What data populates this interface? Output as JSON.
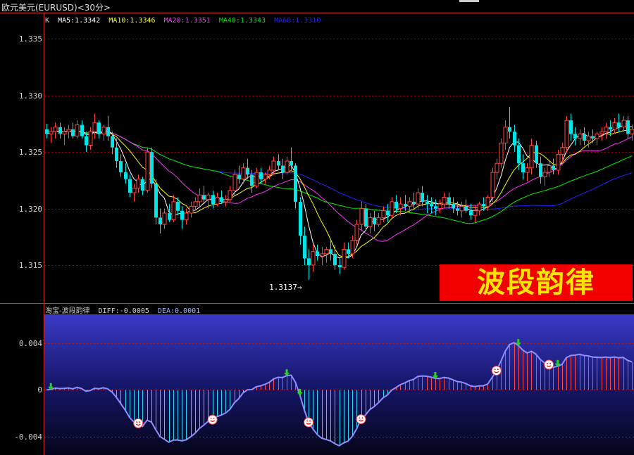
{
  "window": {
    "title": "欧元美元(EURUSD)<30分>"
  },
  "legend": {
    "k": "K",
    "ma5": "MA5:1.3342",
    "ma10": "MA10:1.3346",
    "ma20": "MA20:1.3351",
    "ma40": "MA40:1.3343",
    "ma60": "MA60:1.3310"
  },
  "indicator": {
    "name": "淘宝-波段韵律",
    "diff": "DIFF:-0.0005",
    "dea": "DEA:0.0001"
  },
  "banner": {
    "text": "波段韵律"
  },
  "annotation": {
    "low_label": "1.3137→"
  },
  "colors": {
    "up": "#ff4444",
    "down": "#00e5e5",
    "ma5": "#ffffff",
    "ma10": "#ffff00",
    "ma20": "#ff33ff",
    "ma40": "#00ee00",
    "ma60": "#2222ff",
    "grid": "#a00000"
  },
  "chart_data": [
    {
      "type": "candlestick",
      "title": "",
      "y_ticks": [
        "1.335",
        "1.330",
        "1.325",
        "1.320",
        "1.315"
      ],
      "ylim": [
        1.3117,
        1.3372
      ],
      "candles": [
        [
          1.327,
          1.3275,
          1.3262,
          1.3266
        ],
        [
          1.3266,
          1.3272,
          1.3258,
          1.3268
        ],
        [
          1.3268,
          1.3276,
          1.3262,
          1.3272
        ],
        [
          1.3272,
          1.3276,
          1.3262,
          1.3266
        ],
        [
          1.3266,
          1.3272,
          1.3256,
          1.3268
        ],
        [
          1.3268,
          1.3274,
          1.3262,
          1.327
        ],
        [
          1.327,
          1.3276,
          1.3262,
          1.3264
        ],
        [
          1.3264,
          1.3278,
          1.3262,
          1.3274
        ],
        [
          1.3274,
          1.3278,
          1.3262,
          1.3264
        ],
        [
          1.3264,
          1.3268,
          1.325,
          1.3256
        ],
        [
          1.3256,
          1.3272,
          1.3252,
          1.3268
        ],
        [
          1.3268,
          1.3284,
          1.3262,
          1.3276
        ],
        [
          1.3276,
          1.3278,
          1.3262,
          1.3266
        ],
        [
          1.3266,
          1.3274,
          1.326,
          1.3272
        ],
        [
          1.3272,
          1.3282,
          1.326,
          1.3264
        ],
        [
          1.3264,
          1.3268,
          1.3248,
          1.3254
        ],
        [
          1.3254,
          1.3262,
          1.3236,
          1.3242
        ],
        [
          1.3242,
          1.3248,
          1.3228,
          1.3232
        ],
        [
          1.3232,
          1.324,
          1.3222,
          1.3226
        ],
        [
          1.3226,
          1.323,
          1.321,
          1.3214
        ],
        [
          1.3214,
          1.3222,
          1.3206,
          1.3218
        ],
        [
          1.3218,
          1.323,
          1.3214,
          1.3226
        ],
        [
          1.3226,
          1.3228,
          1.3212,
          1.3216
        ],
        [
          1.3216,
          1.3254,
          1.3214,
          1.325
        ],
        [
          1.325,
          1.3254,
          1.3218,
          1.3222
        ],
        [
          1.3222,
          1.3226,
          1.3186,
          1.3192
        ],
        [
          1.3192,
          1.32,
          1.3178,
          1.3186
        ],
        [
          1.3186,
          1.32,
          1.3182,
          1.3196
        ],
        [
          1.3196,
          1.3204,
          1.3188,
          1.319
        ],
        [
          1.319,
          1.3212,
          1.3188,
          1.3206
        ],
        [
          1.3206,
          1.321,
          1.3194,
          1.3198
        ],
        [
          1.3198,
          1.3202,
          1.3182,
          1.319
        ],
        [
          1.319,
          1.32,
          1.3186,
          1.3196
        ],
        [
          1.3196,
          1.3206,
          1.3192,
          1.3202
        ],
        [
          1.3202,
          1.321,
          1.3198,
          1.3206
        ],
        [
          1.3206,
          1.3218,
          1.3202,
          1.3212
        ],
        [
          1.3212,
          1.322,
          1.3204,
          1.3208
        ],
        [
          1.3208,
          1.3214,
          1.32,
          1.3212
        ],
        [
          1.3212,
          1.3216,
          1.32,
          1.3204
        ],
        [
          1.3204,
          1.3214,
          1.3202,
          1.321
        ],
        [
          1.321,
          1.3216,
          1.3204,
          1.3206
        ],
        [
          1.3206,
          1.3212,
          1.3202,
          1.3208
        ],
        [
          1.3208,
          1.322,
          1.3206,
          1.3216
        ],
        [
          1.3216,
          1.3234,
          1.3212,
          1.323
        ],
        [
          1.323,
          1.3238,
          1.3222,
          1.3226
        ],
        [
          1.3226,
          1.324,
          1.3222,
          1.3236
        ],
        [
          1.3236,
          1.3244,
          1.3226,
          1.323
        ],
        [
          1.323,
          1.3234,
          1.3214,
          1.322
        ],
        [
          1.322,
          1.3236,
          1.3218,
          1.3232
        ],
        [
          1.3232,
          1.3236,
          1.3222,
          1.3226
        ],
        [
          1.3226,
          1.3232,
          1.3222,
          1.323
        ],
        [
          1.323,
          1.3238,
          1.3226,
          1.3234
        ],
        [
          1.3234,
          1.3246,
          1.323,
          1.3242
        ],
        [
          1.3242,
          1.3248,
          1.3234,
          1.3238
        ],
        [
          1.3238,
          1.3244,
          1.3226,
          1.3232
        ],
        [
          1.3232,
          1.3246,
          1.323,
          1.3242
        ],
        [
          1.3242,
          1.3254,
          1.3234,
          1.3238
        ],
        [
          1.3238,
          1.324,
          1.32,
          1.3206
        ],
        [
          1.3206,
          1.321,
          1.3168,
          1.3176
        ],
        [
          1.3176,
          1.3184,
          1.315,
          1.3156
        ],
        [
          1.3156,
          1.3164,
          1.3137,
          1.315
        ],
        [
          1.315,
          1.3168,
          1.3144,
          1.3162
        ],
        [
          1.3162,
          1.3168,
          1.3154,
          1.3158
        ],
        [
          1.3158,
          1.3166,
          1.315,
          1.316
        ],
        [
          1.316,
          1.3166,
          1.3152,
          1.3164
        ],
        [
          1.3164,
          1.3172,
          1.3154,
          1.316
        ],
        [
          1.316,
          1.3168,
          1.3146,
          1.315
        ],
        [
          1.315,
          1.3156,
          1.3142,
          1.3148
        ],
        [
          1.3148,
          1.317,
          1.3146,
          1.3164
        ],
        [
          1.3164,
          1.317,
          1.3156,
          1.316
        ],
        [
          1.316,
          1.3176,
          1.3156,
          1.3172
        ],
        [
          1.3172,
          1.319,
          1.3168,
          1.3186
        ],
        [
          1.3186,
          1.3206,
          1.318,
          1.32
        ],
        [
          1.32,
          1.3204,
          1.318,
          1.3184
        ],
        [
          1.3184,
          1.3196,
          1.3178,
          1.3192
        ],
        [
          1.3192,
          1.3198,
          1.318,
          1.3186
        ],
        [
          1.3186,
          1.3196,
          1.3184,
          1.3192
        ],
        [
          1.3192,
          1.3202,
          1.3188,
          1.3198
        ],
        [
          1.3198,
          1.3204,
          1.3188,
          1.3194
        ],
        [
          1.3194,
          1.321,
          1.3192,
          1.3206
        ],
        [
          1.3206,
          1.3212,
          1.3196,
          1.32
        ],
        [
          1.32,
          1.321,
          1.3194,
          1.3204
        ],
        [
          1.3204,
          1.3212,
          1.3198,
          1.3202
        ],
        [
          1.3202,
          1.321,
          1.3196,
          1.3206
        ],
        [
          1.3206,
          1.3214,
          1.32,
          1.3204
        ],
        [
          1.3204,
          1.3218,
          1.32,
          1.3214
        ],
        [
          1.3214,
          1.322,
          1.3202,
          1.3206
        ],
        [
          1.3206,
          1.3212,
          1.3196,
          1.3204
        ],
        [
          1.3204,
          1.321,
          1.3196,
          1.3202
        ],
        [
          1.3202,
          1.3208,
          1.3194,
          1.32
        ],
        [
          1.32,
          1.3208,
          1.3196,
          1.3204
        ],
        [
          1.3204,
          1.3214,
          1.32,
          1.321
        ],
        [
          1.321,
          1.3214,
          1.32,
          1.3204
        ],
        [
          1.3204,
          1.321,
          1.3196,
          1.32
        ],
        [
          1.32,
          1.3206,
          1.3194,
          1.3198
        ],
        [
          1.3198,
          1.3206,
          1.3192,
          1.3202
        ],
        [
          1.3202,
          1.3208,
          1.3196,
          1.3198
        ],
        [
          1.3198,
          1.3204,
          1.319,
          1.3194
        ],
        [
          1.3194,
          1.3202,
          1.3188,
          1.3198
        ],
        [
          1.3198,
          1.3206,
          1.3194,
          1.3204
        ],
        [
          1.3204,
          1.321,
          1.3198,
          1.3202
        ],
        [
          1.3202,
          1.3212,
          1.3198,
          1.321
        ],
        [
          1.321,
          1.3236,
          1.3206,
          1.3232
        ],
        [
          1.3232,
          1.3244,
          1.3226,
          1.324
        ],
        [
          1.324,
          1.3262,
          1.3236,
          1.3258
        ],
        [
          1.3258,
          1.3278,
          1.3252,
          1.3272
        ],
        [
          1.3272,
          1.329,
          1.3262,
          1.3268
        ],
        [
          1.3268,
          1.3274,
          1.325,
          1.3256
        ],
        [
          1.3256,
          1.3262,
          1.3234,
          1.324
        ],
        [
          1.324,
          1.3248,
          1.3226,
          1.3232
        ],
        [
          1.3232,
          1.324,
          1.3224,
          1.3236
        ],
        [
          1.3236,
          1.3262,
          1.323,
          1.3256
        ],
        [
          1.3256,
          1.326,
          1.3236,
          1.324
        ],
        [
          1.324,
          1.3246,
          1.3222,
          1.3228
        ],
        [
          1.3228,
          1.3236,
          1.322,
          1.3232
        ],
        [
          1.3232,
          1.3242,
          1.3228,
          1.3238
        ],
        [
          1.3238,
          1.3244,
          1.323,
          1.3234
        ],
        [
          1.3234,
          1.3252,
          1.323,
          1.3248
        ],
        [
          1.3248,
          1.3258,
          1.324,
          1.3254
        ],
        [
          1.3254,
          1.3282,
          1.325,
          1.3278
        ],
        [
          1.3278,
          1.3284,
          1.326,
          1.3266
        ],
        [
          1.3266,
          1.3272,
          1.3256,
          1.3262
        ],
        [
          1.3262,
          1.327,
          1.3256,
          1.3266
        ],
        [
          1.3266,
          1.3272,
          1.3256,
          1.326
        ],
        [
          1.326,
          1.3268,
          1.3254,
          1.3264
        ],
        [
          1.3264,
          1.327,
          1.3258,
          1.3262
        ],
        [
          1.3262,
          1.3268,
          1.3256,
          1.3266
        ],
        [
          1.3266,
          1.3272,
          1.326,
          1.3268
        ],
        [
          1.3268,
          1.3276,
          1.3262,
          1.3272
        ],
        [
          1.3272,
          1.3278,
          1.3264,
          1.327
        ],
        [
          1.327,
          1.328,
          1.3266,
          1.3276
        ],
        [
          1.3276,
          1.3284,
          1.3268,
          1.3272
        ],
        [
          1.3272,
          1.3282,
          1.3268,
          1.3278
        ],
        [
          1.3278,
          1.3282,
          1.3262,
          1.3266
        ],
        [
          1.3266,
          1.3274,
          1.326,
          1.327
        ]
      ],
      "low_marker": 1.3137
    },
    {
      "type": "bar+line",
      "title": "",
      "y_ticks": [
        "0.004",
        "0",
        "-0.004"
      ],
      "ylim": [
        -0.0056,
        0.0065
      ],
      "smileys": [
        21,
        38,
        60,
        72,
        103,
        115
      ],
      "arrows": [
        1,
        55,
        58,
        89,
        108,
        117
      ]
    }
  ]
}
